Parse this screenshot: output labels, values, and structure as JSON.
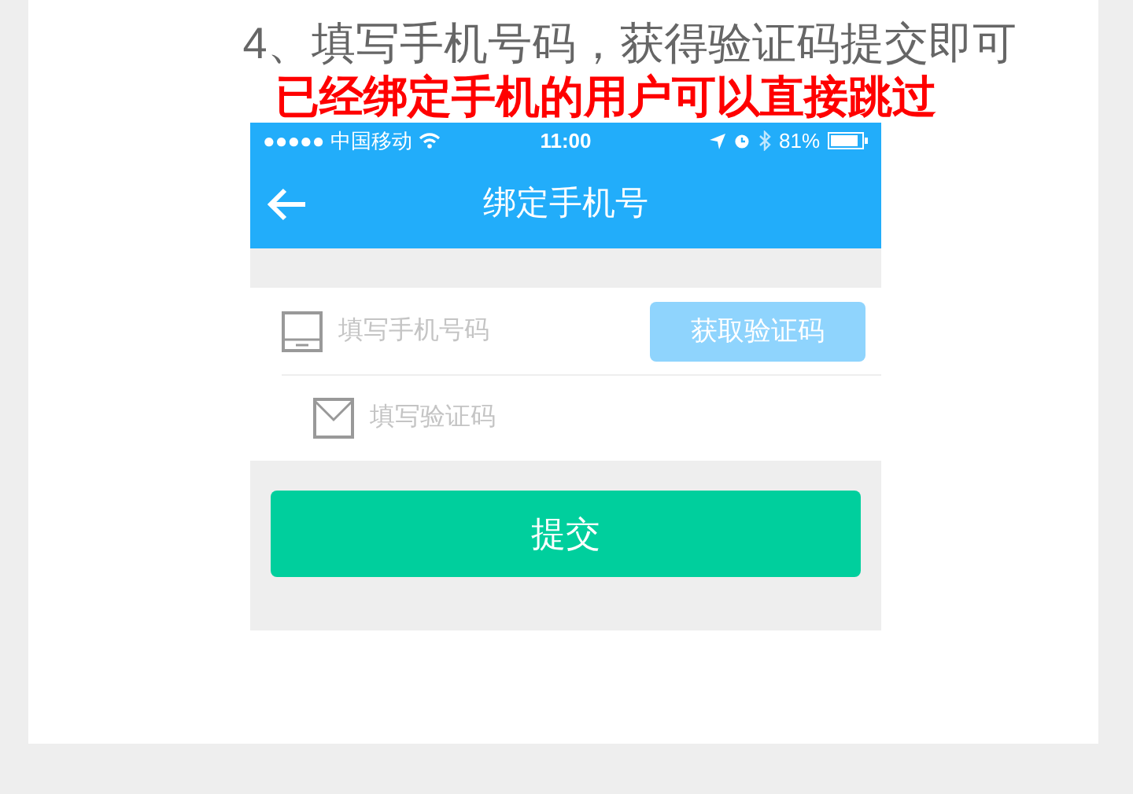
{
  "instruction": "4、填写手机号码，获得验证码提交即可",
  "note": "已经绑定手机的用户可以直接跳过",
  "status_bar": {
    "carrier": "●●●●● 中国移动",
    "time": "11:00",
    "battery": "81%"
  },
  "nav_bar": {
    "title": "绑定手机号"
  },
  "form": {
    "fields": [
      {
        "kind": "phone",
        "placeholder": "填写手机号码",
        "button": "获取验证码"
      },
      {
        "kind": "code",
        "placeholder": "填写验证码"
      }
    ],
    "submit": "提交"
  }
}
